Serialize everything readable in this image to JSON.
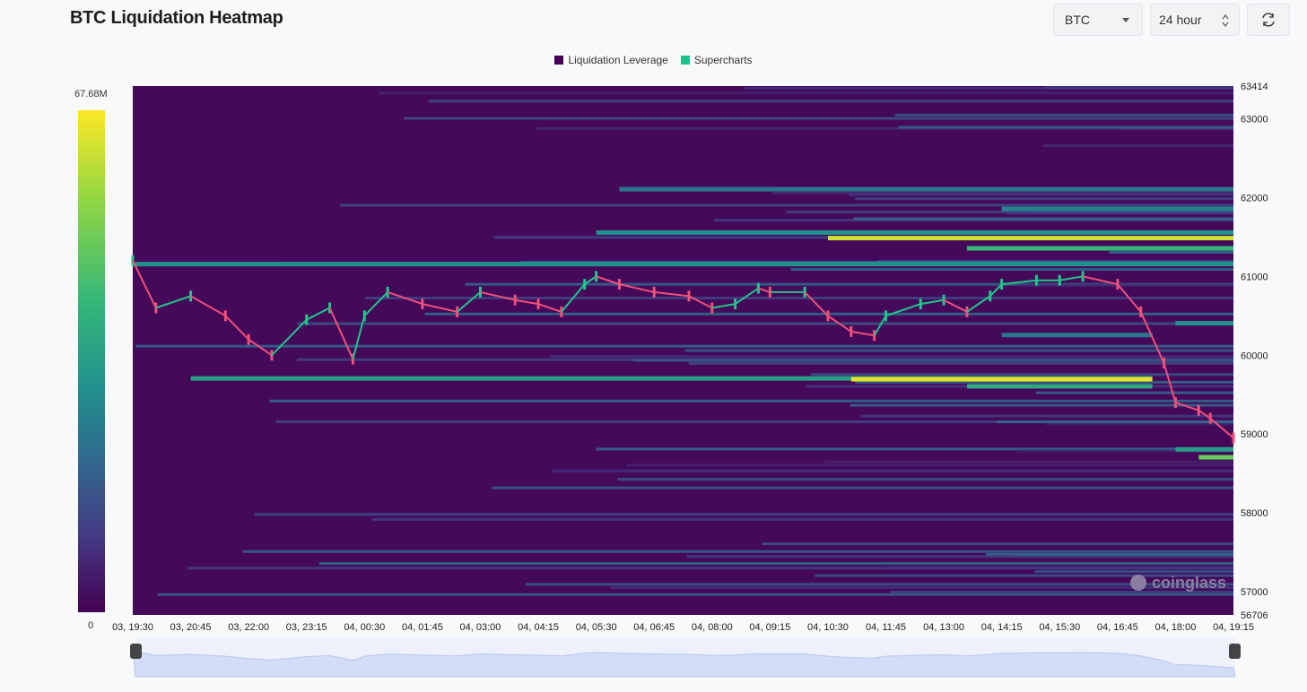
{
  "header": {
    "title": "BTC Liquidation Heatmap"
  },
  "controls": {
    "coin": "BTC",
    "range": "24 hour",
    "refresh_icon": "refresh-icon"
  },
  "legend": [
    {
      "label": "Liquidation Leverage",
      "color": "#440154"
    },
    {
      "label": "Supercharts",
      "color": "#20c08a"
    }
  ],
  "color_scale": {
    "max_label": "67.68M",
    "min_label": "0"
  },
  "watermark": "coinglass",
  "chart_data": {
    "type": "heatmap",
    "title": "BTC Liquidation Heatmap",
    "ylim": [
      56706,
      63414
    ],
    "y_ticks": [
      63414,
      63000,
      62000,
      61000,
      60000,
      59000,
      58000,
      57000,
      56706
    ],
    "x_ticks": [
      "03, 19:30",
      "03, 20:45",
      "03, 22:00",
      "03, 23:15",
      "04, 00:30",
      "04, 01:45",
      "04, 03:00",
      "04, 04:15",
      "04, 05:30",
      "04, 06:45",
      "04, 08:00",
      "04, 09:15",
      "04, 10:30",
      "04, 11:45",
      "04, 13:00",
      "04, 14:15",
      "04, 15:30",
      "04, 16:45",
      "04, 18:00",
      "04, 19:15"
    ],
    "colorbar": {
      "min": 0,
      "max": 67680000
    },
    "heat_bands": [
      {
        "price": 61550,
        "from": "04, 05:30",
        "to": "04, 19:15",
        "intensity": 0.45
      },
      {
        "price": 61480,
        "from": "04, 10:30",
        "to": "04, 19:15",
        "intensity": 0.9
      },
      {
        "price": 61350,
        "from": "04, 13:30",
        "to": "04, 19:15",
        "intensity": 0.6
      },
      {
        "price": 61150,
        "from": "03, 19:30",
        "to": "04, 19:15",
        "intensity": 0.45
      },
      {
        "price": 62100,
        "from": "04, 06:00",
        "to": "04, 19:15",
        "intensity": 0.35
      },
      {
        "price": 61850,
        "from": "04, 14:15",
        "to": "04, 19:15",
        "intensity": 0.4
      },
      {
        "price": 60250,
        "from": "04, 14:15",
        "to": "04, 17:30",
        "intensity": 0.35
      },
      {
        "price": 59700,
        "from": "03, 20:45",
        "to": "04, 17:30",
        "intensity": 0.5
      },
      {
        "price": 59690,
        "from": "04, 11:00",
        "to": "04, 17:30",
        "intensity": 0.95
      },
      {
        "price": 59600,
        "from": "04, 13:30",
        "to": "04, 17:30",
        "intensity": 0.55
      },
      {
        "price": 60400,
        "from": "04, 18:00",
        "to": "04, 19:15",
        "intensity": 0.45
      },
      {
        "price": 58800,
        "from": "04, 18:00",
        "to": "04, 19:15",
        "intensity": 0.5
      },
      {
        "price": 58700,
        "from": "04, 18:30",
        "to": "04, 19:15",
        "intensity": 0.7
      }
    ],
    "candles": [
      {
        "time": "03, 19:30",
        "price": 61200
      },
      {
        "time": "03, 20:00",
        "price": 60600
      },
      {
        "time": "03, 20:45",
        "price": 60750
      },
      {
        "time": "03, 21:30",
        "price": 60500
      },
      {
        "time": "03, 22:00",
        "price": 60200
      },
      {
        "time": "03, 22:30",
        "price": 60000
      },
      {
        "time": "03, 23:15",
        "price": 60450
      },
      {
        "time": "03, 23:45",
        "price": 60600
      },
      {
        "time": "04, 00:15",
        "price": 59950
      },
      {
        "time": "04, 00:30",
        "price": 60500
      },
      {
        "time": "04, 01:00",
        "price": 60800
      },
      {
        "time": "04, 01:45",
        "price": 60650
      },
      {
        "time": "04, 02:30",
        "price": 60550
      },
      {
        "time": "04, 03:00",
        "price": 60800
      },
      {
        "time": "04, 03:45",
        "price": 60700
      },
      {
        "time": "04, 04:15",
        "price": 60650
      },
      {
        "time": "04, 04:45",
        "price": 60550
      },
      {
        "time": "04, 05:15",
        "price": 60900
      },
      {
        "time": "04, 05:30",
        "price": 61000
      },
      {
        "time": "04, 06:00",
        "price": 60900
      },
      {
        "time": "04, 06:45",
        "price": 60800
      },
      {
        "time": "04, 07:30",
        "price": 60750
      },
      {
        "time": "04, 08:00",
        "price": 60600
      },
      {
        "time": "04, 08:30",
        "price": 60650
      },
      {
        "time": "04, 09:00",
        "price": 60850
      },
      {
        "time": "04, 09:15",
        "price": 60800
      },
      {
        "time": "04, 10:00",
        "price": 60800
      },
      {
        "time": "04, 10:30",
        "price": 60500
      },
      {
        "time": "04, 11:00",
        "price": 60300
      },
      {
        "time": "04, 11:30",
        "price": 60250
      },
      {
        "time": "04, 11:45",
        "price": 60500
      },
      {
        "time": "04, 12:30",
        "price": 60650
      },
      {
        "time": "04, 13:00",
        "price": 60700
      },
      {
        "time": "04, 13:30",
        "price": 60550
      },
      {
        "time": "04, 14:00",
        "price": 60750
      },
      {
        "time": "04, 14:15",
        "price": 60900
      },
      {
        "time": "04, 15:00",
        "price": 60950
      },
      {
        "time": "04, 15:30",
        "price": 60950
      },
      {
        "time": "04, 16:00",
        "price": 61000
      },
      {
        "time": "04, 16:45",
        "price": 60900
      },
      {
        "time": "04, 17:15",
        "price": 60550
      },
      {
        "time": "04, 17:45",
        "price": 59900
      },
      {
        "time": "04, 18:00",
        "price": 59400
      },
      {
        "time": "04, 18:30",
        "price": 59300
      },
      {
        "time": "04, 18:45",
        "price": 59200
      },
      {
        "time": "04, 19:15",
        "price": 58950
      }
    ]
  }
}
